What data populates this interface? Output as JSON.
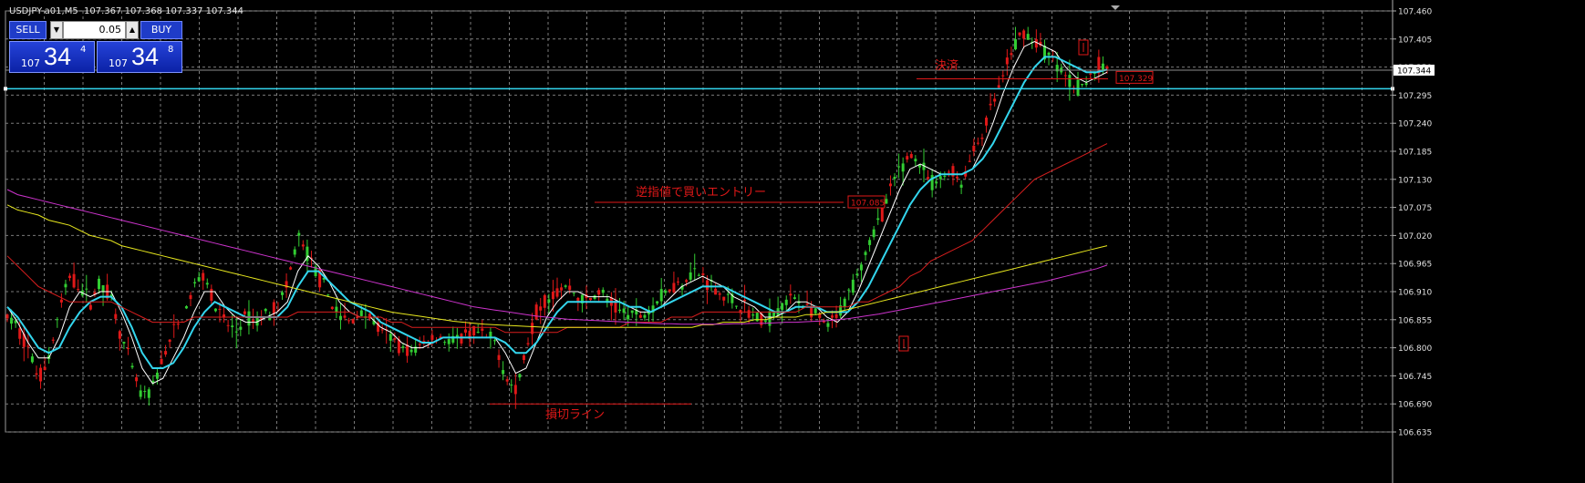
{
  "header": {
    "symbol": "USDJPY-a01,M5",
    "ohlc": "107.367 107.368 107.337 107.344"
  },
  "trade_panel": {
    "sell_label": "SELL",
    "buy_label": "BUY",
    "lot": "0.05",
    "sell_prefix": "107",
    "sell_big": "34",
    "sell_sup": "4",
    "buy_prefix": "107",
    "buy_big": "34",
    "buy_sup": "8"
  },
  "chart_data": {
    "type": "candlestick",
    "y_ticks": [
      "107.460",
      "107.405",
      "107.350",
      "107.295",
      "107.240",
      "107.185",
      "107.130",
      "107.075",
      "107.020",
      "106.965",
      "106.910",
      "106.855",
      "106.800",
      "106.745",
      "106.690",
      "106.635"
    ],
    "ylim": [
      106.635,
      107.46
    ],
    "grid": true,
    "current_price": "107.344",
    "horizontal_line_price": 107.3075,
    "price_sequence": [
      106.86,
      106.84,
      106.8,
      106.74,
      106.78,
      106.87,
      106.94,
      106.92,
      106.89,
      106.93,
      106.9,
      106.82,
      106.76,
      106.7,
      106.72,
      106.78,
      106.83,
      106.86,
      106.92,
      106.95,
      106.88,
      106.85,
      106.83,
      106.86,
      106.85,
      106.87,
      106.88,
      106.92,
      107.02,
      106.98,
      106.94,
      106.9,
      106.86,
      106.85,
      106.87,
      106.86,
      106.83,
      106.82,
      106.8,
      106.79,
      106.81,
      106.82,
      106.82,
      106.81,
      106.82,
      106.83,
      106.82,
      106.81,
      106.75,
      106.71,
      106.8,
      106.87,
      106.9,
      106.91,
      106.92,
      106.9,
      106.89,
      106.91,
      106.89,
      106.87,
      106.87,
      106.86,
      106.88,
      106.9,
      106.92,
      106.93,
      106.95,
      106.94,
      106.92,
      106.9,
      106.89,
      106.88,
      106.86,
      106.85,
      106.87,
      106.89,
      106.9,
      106.88,
      106.86,
      106.84,
      106.86,
      106.9,
      106.95,
      107.0,
      107.05,
      107.1,
      107.15,
      107.18,
      107.16,
      107.12,
      107.13,
      107.15,
      107.12,
      107.18,
      107.22,
      107.28,
      107.33,
      107.39,
      107.42,
      107.4,
      107.38,
      107.36,
      107.33,
      107.31,
      107.32,
      107.35,
      107.35
    ],
    "moving_averages": [
      {
        "color": "#ffffff",
        "values": [
          106.88,
          106.85,
          106.81,
          106.78,
          106.78,
          106.82,
          106.88,
          106.91,
          106.9,
          106.91,
          106.91,
          106.87,
          106.82,
          106.76,
          106.73,
          106.74,
          106.78,
          106.82,
          106.87,
          106.91,
          106.91,
          106.88,
          106.86,
          106.85,
          106.85,
          106.86,
          106.87,
          106.89,
          106.95,
          106.98,
          106.96,
          106.93,
          106.89,
          106.87,
          106.86,
          106.86,
          106.84,
          106.83,
          106.81,
          106.8,
          106.8,
          106.81,
          106.82,
          106.82,
          106.82,
          106.82,
          106.82,
          106.82,
          106.79,
          106.75,
          106.76,
          106.81,
          106.86,
          106.89,
          106.91,
          106.91,
          106.9,
          106.9,
          106.9,
          106.89,
          106.88,
          106.87,
          106.87,
          106.88,
          106.9,
          106.92,
          106.93,
          106.94,
          106.93,
          106.92,
          106.9,
          106.89,
          106.88,
          106.86,
          106.86,
          106.87,
          106.89,
          106.89,
          106.88,
          106.86,
          106.85,
          106.87,
          106.91,
          106.96,
          107.01,
          107.06,
          107.11,
          107.15,
          107.16,
          107.15,
          107.14,
          107.14,
          107.14,
          107.15,
          107.19,
          107.24,
          107.3,
          107.35,
          107.39,
          107.4,
          107.39,
          107.38,
          107.35,
          107.33,
          107.32,
          107.33,
          107.34
        ]
      },
      {
        "color": "#33d6ee",
        "values": [
          106.88,
          106.86,
          106.83,
          106.8,
          106.79,
          106.8,
          106.84,
          106.87,
          106.89,
          106.9,
          106.9,
          106.88,
          106.84,
          106.79,
          106.76,
          106.76,
          106.77,
          106.8,
          106.84,
          106.87,
          106.89,
          106.88,
          106.87,
          106.86,
          106.86,
          106.86,
          106.86,
          106.88,
          106.92,
          106.95,
          106.95,
          106.93,
          106.91,
          106.89,
          106.88,
          106.87,
          106.85,
          106.84,
          106.83,
          106.82,
          106.81,
          106.81,
          106.82,
          106.82,
          106.82,
          106.82,
          106.82,
          106.82,
          106.81,
          106.79,
          106.79,
          106.81,
          106.84,
          106.87,
          106.89,
          106.89,
          106.89,
          106.89,
          106.89,
          106.89,
          106.88,
          106.88,
          106.87,
          106.88,
          106.89,
          106.9,
          106.91,
          106.92,
          106.92,
          106.92,
          106.91,
          106.9,
          106.89,
          106.88,
          106.87,
          106.87,
          106.88,
          106.88,
          106.88,
          106.87,
          106.87,
          106.87,
          106.89,
          106.92,
          106.96,
          107.0,
          107.04,
          107.08,
          107.11,
          107.13,
          107.14,
          107.14,
          107.14,
          107.15,
          107.17,
          107.2,
          107.24,
          107.28,
          107.32,
          107.35,
          107.37,
          107.37,
          107.36,
          107.35,
          107.34,
          107.34,
          107.345
        ]
      },
      {
        "color": "#d91e1e",
        "values": [
          106.98,
          106.96,
          106.94,
          106.92,
          106.91,
          106.9,
          106.89,
          106.89,
          106.89,
          106.89,
          106.89,
          106.88,
          106.87,
          106.86,
          106.85,
          106.85,
          106.85,
          106.85,
          106.86,
          106.86,
          106.86,
          106.86,
          106.86,
          106.86,
          106.86,
          106.86,
          106.86,
          106.86,
          106.87,
          106.87,
          106.87,
          106.87,
          106.87,
          106.87,
          106.86,
          106.86,
          106.86,
          106.85,
          106.85,
          106.84,
          106.84,
          106.84,
          106.84,
          106.84,
          106.84,
          106.84,
          106.84,
          106.84,
          106.83,
          106.83,
          106.83,
          106.83,
          106.83,
          106.83,
          106.84,
          106.84,
          106.84,
          106.84,
          106.84,
          106.84,
          106.85,
          106.85,
          106.85,
          106.85,
          106.86,
          106.86,
          106.86,
          106.87,
          106.87,
          106.87,
          106.87,
          106.87,
          106.87,
          106.87,
          106.87,
          106.87,
          106.87,
          106.88,
          106.88,
          106.88,
          106.88,
          106.88,
          106.89,
          106.89,
          106.9,
          106.91,
          106.92,
          106.94,
          106.95,
          106.97,
          106.98,
          106.99,
          107.0,
          107.01,
          107.03,
          107.05,
          107.07,
          107.09,
          107.11,
          107.13,
          107.14,
          107.15,
          107.16,
          107.17,
          107.18,
          107.19,
          107.2
        ]
      },
      {
        "color": "#e8e81e",
        "values": [
          107.08,
          107.07,
          107.065,
          107.06,
          107.05,
          107.045,
          107.04,
          107.03,
          107.02,
          107.015,
          107.01,
          107.0,
          106.995,
          106.99,
          106.985,
          106.98,
          106.975,
          106.97,
          106.965,
          106.96,
          106.955,
          106.95,
          106.945,
          106.94,
          106.935,
          106.93,
          106.925,
          106.92,
          106.915,
          106.91,
          106.905,
          106.9,
          106.895,
          106.89,
          106.885,
          106.88,
          106.875,
          106.87,
          106.867,
          106.864,
          106.861,
          106.858,
          106.855,
          106.852,
          106.85,
          106.848,
          106.846,
          106.845,
          106.844,
          106.843,
          106.842,
          106.841,
          106.84,
          106.84,
          106.84,
          106.84,
          106.84,
          106.84,
          106.84,
          106.84,
          106.84,
          106.84,
          106.84,
          106.84,
          106.84,
          106.84,
          106.84,
          106.845,
          106.845,
          106.85,
          106.85,
          106.85,
          106.855,
          106.855,
          106.86,
          106.86,
          106.86,
          106.865,
          106.865,
          106.87,
          106.87,
          106.875,
          106.88,
          106.885,
          106.89,
          106.895,
          106.9,
          106.905,
          106.91,
          106.915,
          106.92,
          106.925,
          106.93,
          106.935,
          106.94,
          106.945,
          106.95,
          106.955,
          106.96,
          106.965,
          106.97,
          106.975,
          106.98,
          106.985,
          106.99,
          106.995,
          107.0
        ]
      },
      {
        "color": "#cc33cc",
        "values": [
          107.11,
          107.1,
          107.095,
          107.09,
          107.085,
          107.08,
          107.075,
          107.07,
          107.065,
          107.06,
          107.055,
          107.05,
          107.045,
          107.04,
          107.035,
          107.03,
          107.025,
          107.02,
          107.015,
          107.01,
          107.005,
          107.0,
          106.995,
          106.99,
          106.985,
          106.98,
          106.975,
          106.97,
          106.965,
          106.96,
          106.955,
          106.95,
          106.945,
          106.94,
          106.935,
          106.93,
          106.925,
          106.92,
          106.915,
          106.91,
          106.905,
          106.9,
          106.895,
          106.89,
          106.885,
          106.88,
          106.877,
          106.874,
          106.871,
          106.868,
          106.865,
          106.862,
          106.86,
          106.858,
          106.856,
          106.855,
          106.854,
          106.853,
          106.852,
          106.851,
          106.85,
          106.849,
          106.848,
          106.847,
          106.847,
          106.846,
          106.846,
          106.846,
          106.846,
          106.846,
          106.847,
          106.847,
          106.848,
          106.848,
          106.849,
          106.85,
          106.85,
          106.851,
          106.852,
          106.853,
          106.855,
          106.857,
          106.86,
          106.863,
          106.866,
          106.87,
          106.874,
          106.878,
          106.882,
          106.886,
          106.89,
          106.894,
          106.898,
          106.902,
          106.906,
          106.91,
          106.914,
          106.918,
          106.922,
          106.926,
          106.93,
          106.935,
          106.94,
          106.945,
          106.95,
          106.955,
          106.962
        ]
      }
    ],
    "annotations": [
      {
        "text": "決済",
        "price": 107.327
      },
      {
        "text": "逆指値で買いエントリー",
        "price": 107.085
      },
      {
        "text": "損切ライン",
        "price": 106.69
      }
    ],
    "price_labels": [
      "107.085",
      "107.329"
    ]
  }
}
